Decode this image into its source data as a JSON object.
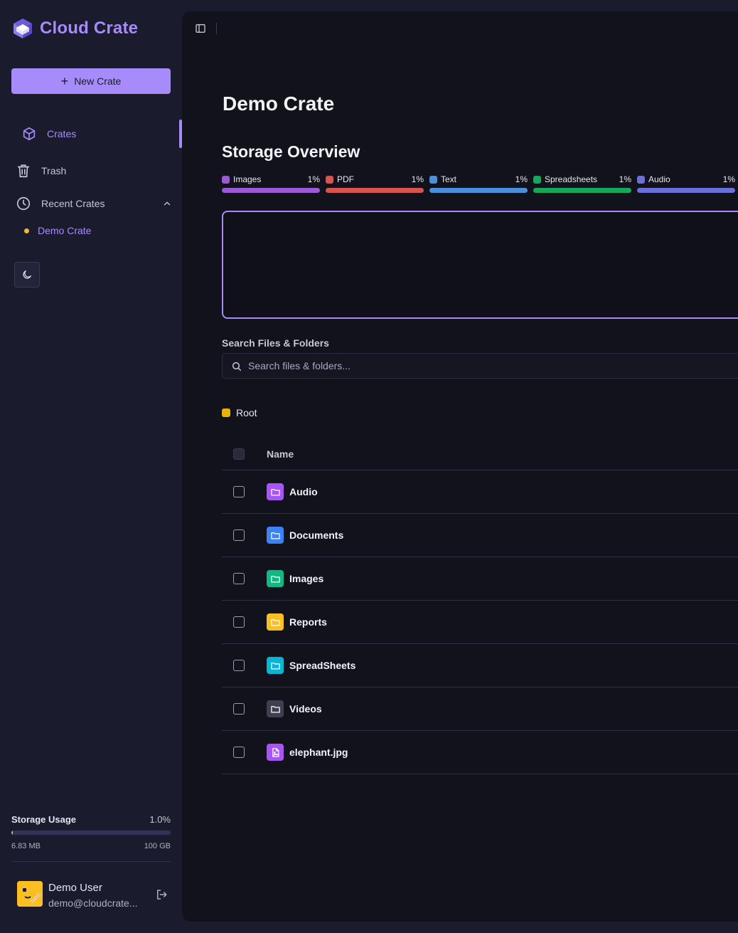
{
  "app": {
    "name": "Cloud Crate"
  },
  "sidebar": {
    "new_button_label": "New Crate",
    "nav": {
      "crates": "Crates",
      "trash": "Trash",
      "recent": "Recent Crates"
    },
    "recent_items": [
      "Demo Crate"
    ]
  },
  "storage": {
    "title": "Storage Usage",
    "percent_label": "1.0%",
    "fill_fraction": 0.01,
    "used": "6.83 MB",
    "total": "100 GB"
  },
  "user": {
    "name": "Demo User",
    "email": "demo@cloudcrate..."
  },
  "main": {
    "title": "Demo Crate",
    "overview_title": "Storage Overview",
    "legend": [
      {
        "label": "Images",
        "pct": "1%",
        "color": "#9b59d6"
      },
      {
        "label": "PDF",
        "pct": "1%",
        "color": "#d9534f"
      },
      {
        "label": "Text",
        "pct": "1%",
        "color": "#4a8fdb"
      },
      {
        "label": "Spreadsheets",
        "pct": "1%",
        "color": "#16a85a"
      },
      {
        "label": "Audio",
        "pct": "1%",
        "color": "#6b6fd8"
      }
    ],
    "search": {
      "label": "Search Files & Folders",
      "placeholder": "Search files & folders..."
    },
    "breadcrumb": "Root",
    "table": {
      "name_header": "Name",
      "rows": [
        {
          "name": "Audio",
          "icon": "folder-icon",
          "color": "#a855f7"
        },
        {
          "name": "Documents",
          "icon": "folder-icon",
          "color": "#3b82f6"
        },
        {
          "name": "Images",
          "icon": "folder-icon",
          "color": "#10b981"
        },
        {
          "name": "Reports",
          "icon": "folder-icon",
          "color": "#fbbf24"
        },
        {
          "name": "SpreadSheets",
          "icon": "folder-icon",
          "color": "#06b6d4"
        },
        {
          "name": "Videos",
          "icon": "folder-icon",
          "color": "#3f3f52"
        },
        {
          "name": "elephant.jpg",
          "icon": "image-file-icon",
          "color": "#a855f7"
        }
      ]
    }
  }
}
